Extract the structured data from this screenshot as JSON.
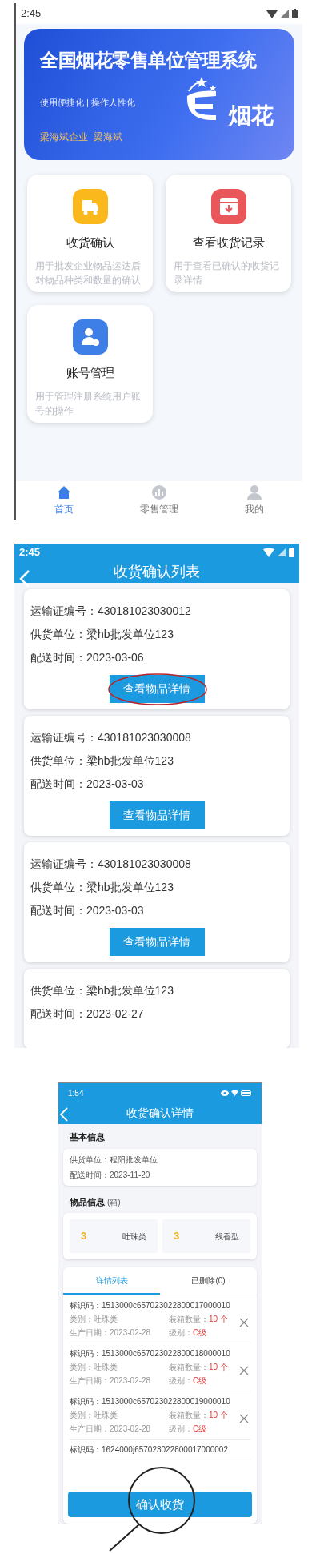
{
  "home_screen": {
    "status_time": "2:45",
    "banner": {
      "title": "全国烟花零售单位管理系统",
      "slogan": "使用便捷化 | 操作人性化",
      "company": "梁海斌企业  梁海斌",
      "logo_text": "烟花"
    },
    "features": [
      {
        "title": "收货确认",
        "description": "用于批发企业物品运达后对物品种类和数量的确认",
        "color": "#fbb81c"
      },
      {
        "title": "查看收货记录",
        "description": "用于查看已确认的收货记录详情",
        "color": "#e9575a"
      },
      {
        "title": "账号管理",
        "description": "用于管理注册系统用户账号的操作",
        "color": "#3d7fe6"
      }
    ],
    "nav": [
      {
        "label": "首页",
        "selected": true
      },
      {
        "label": "零售管理",
        "selected": false
      },
      {
        "label": "我的",
        "selected": false
      }
    ]
  },
  "list_screen": {
    "status_time": "2:45",
    "title": "收货确认列表",
    "cards": [
      {
        "lines": [
          "运输证编号：430181023030012",
          "供货单位：梁hb批发单位123",
          "配送时间：2023-03-06"
        ],
        "button": "查看物品详情",
        "circled": true
      },
      {
        "lines": [
          "运输证编号：430181023030008",
          "供货单位：梁hb批发单位123",
          "配送时间：2023-03-03"
        ],
        "button": "查看物品详情",
        "circled": false
      },
      {
        "lines": [
          "运输证编号：430181023030008",
          "供货单位：梁hb批发单位123",
          "配送时间：2023-03-03"
        ],
        "button": "查看物品详情",
        "circled": false
      },
      {
        "lines": [
          "供货单位：梁hb批发单位123",
          "配送时间：2023-02-27"
        ]
      }
    ]
  },
  "detail_screen": {
    "status_time": "1:54",
    "title": "收货确认详情",
    "basic_heading": "基本信息",
    "basic_lines": [
      "供货单位：程阳批发单位",
      "配送时间：2023-11-20"
    ],
    "items_heading": "物品信息",
    "items_unit": "(箱)",
    "counts": [
      {
        "count": "3",
        "name": "吐珠类"
      },
      {
        "count": "3",
        "name": "线香型"
      }
    ],
    "tabs": [
      {
        "label": "详情列表",
        "selected": true
      },
      {
        "label": "已删除(0)",
        "selected": false
      }
    ],
    "rows": [
      {
        "code": "标识码：1513000c657023022800017000010",
        "category": "类别：吐珠类",
        "qty_label": "装箱数量：",
        "qty": "10 个",
        "date": "生产日期：2023-02-28",
        "grade_label": "级别：",
        "grade": "C级"
      },
      {
        "code": "标识码：1513000c657023022800018000010",
        "category": "类别：吐珠类",
        "qty_label": "装箱数量：",
        "qty": "10 个",
        "date": "生产日期：2023-02-28",
        "grade_label": "级别：",
        "grade": "C级"
      },
      {
        "code": "标识码：1513000c657023022800019000010",
        "category": "类别：吐珠类",
        "qty_label": "装箱数量：",
        "qty": "10 个",
        "date": "生产日期：2023-02-28",
        "grade_label": "级别：",
        "grade": "C级"
      },
      {
        "code": "标识码：1624000j657023022800017000002"
      }
    ],
    "confirm_button": "确认收货"
  }
}
